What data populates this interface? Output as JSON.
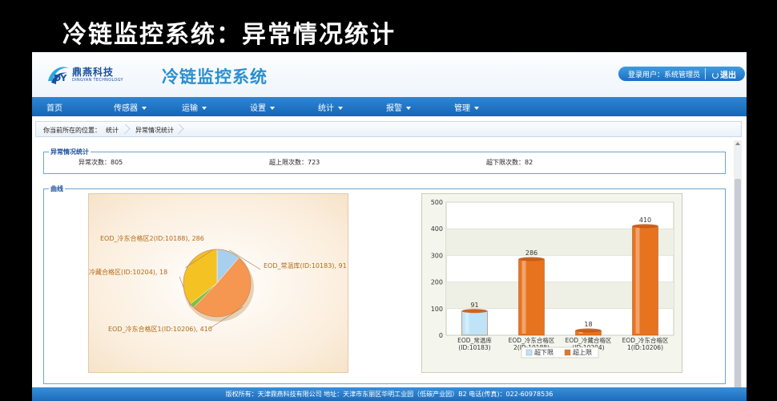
{
  "slide": {
    "title": "冷链监控系统：异常情况统计"
  },
  "header": {
    "logo_cn": "鼎燕科技",
    "logo_en": "DINGYAN TECHNOLOGY",
    "app_name": "冷链监控系统",
    "user_label": "登录用户：系统管理员",
    "logout_label": "退出"
  },
  "nav": {
    "items": [
      {
        "label": "首页",
        "has_menu": false
      },
      {
        "label": "传感器",
        "has_menu": true
      },
      {
        "label": "运输",
        "has_menu": true
      },
      {
        "label": "设置",
        "has_menu": true
      },
      {
        "label": "统计",
        "has_menu": true
      },
      {
        "label": "报警",
        "has_menu": true
      },
      {
        "label": "管理",
        "has_menu": true
      }
    ]
  },
  "breadcrumb": {
    "prefix": "你当前所在的位置：",
    "items": [
      "统计",
      "异常情况统计"
    ]
  },
  "stats": {
    "legend": "异常情况统计",
    "abnormal": "异常次数：805",
    "above": "超上限次数：723",
    "below": "超下限次数：82"
  },
  "curve": {
    "legend": "曲线"
  },
  "chart_data": [
    {
      "type": "pie",
      "slices": [
        {
          "label": "EOD_常温库(ID:10183), 91",
          "value": 91,
          "color": "#a9cfee"
        },
        {
          "label": "EOD_冷东合格区1(ID:10206), 410",
          "value": 410,
          "color": "#f59651"
        },
        {
          "label": "冷藏合格区(ID:10204), 18",
          "value": 18,
          "color": "#7cc043"
        },
        {
          "label": "EOD_冷东合格区2(ID:10188), 286",
          "value": 286,
          "color": "#f5c224"
        }
      ]
    },
    {
      "type": "bar",
      "categories": [
        [
          "EOD_常温库",
          "(ID:10183)"
        ],
        [
          "EOD_冷东合格区",
          "2(ID:10188)"
        ],
        [
          "EOD_冷藏合格区",
          "(ID:10204)"
        ],
        [
          "EOD_冷东合格区",
          "1(ID:10206)"
        ]
      ],
      "series": [
        {
          "name": "超下限",
          "values": [
            91,
            0,
            0,
            0
          ],
          "color": "#bfe4f8"
        },
        {
          "name": "超上限",
          "values": [
            0,
            286,
            18,
            410
          ],
          "color": "#e8731f"
        }
      ],
      "data_labels": [
        "91",
        "286",
        "18",
        "410"
      ],
      "yticks": [
        0,
        100,
        200,
        300,
        400,
        500
      ],
      "ylim": [
        0,
        500
      ],
      "grid": true,
      "legend_position": "bottom"
    }
  ],
  "footer": {
    "text": "版权所有：天津鼎燕科技有限公司 地址：天津市东丽区华明工业园（低碳产业园）B2 电话(传真)：022-60978536"
  }
}
